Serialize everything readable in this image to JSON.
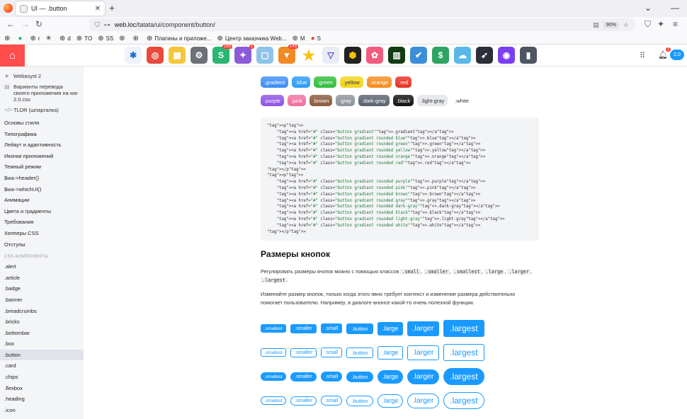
{
  "browser": {
    "tab_title": "UI — .button",
    "new_tab": "+",
    "url_host": "web.loc",
    "url_path": "/tatata/ui/component/button/",
    "zoom": "90%",
    "bookmarks": [
      {
        "label": ""
      },
      {
        "label": ""
      },
      {
        "label": "r"
      },
      {
        "label": ""
      },
      {
        "label": "d"
      },
      {
        "label": "TO"
      },
      {
        "label": "SS"
      },
      {
        "label": ""
      },
      {
        "label": ""
      },
      {
        "label": "Плагины и приложе..."
      },
      {
        "label": "Центр заказчика Web..."
      },
      {
        "label": "M"
      },
      {
        "label": "S"
      }
    ]
  },
  "appbar": {
    "apps": [
      {
        "icon": "asterisk-icon",
        "color": "#eef3fb",
        "badge": ""
      },
      {
        "icon": "lifebuoy-icon",
        "color": "#e84a3c",
        "badge": ""
      },
      {
        "icon": "notes-icon",
        "color": "#f6c63a",
        "badge": ""
      },
      {
        "icon": "gear-icon",
        "color": "#6c7078",
        "badge": ""
      },
      {
        "icon": "shop-icon",
        "color": "#2bb673",
        "badge": "185"
      },
      {
        "icon": "wand-icon",
        "color": "#8c5ad8",
        "badge": "1"
      },
      {
        "icon": "window-icon",
        "color": "#90c3e8",
        "badge": ""
      },
      {
        "icon": "cone-icon",
        "color": "#f08a24",
        "badge": "145"
      },
      {
        "icon": "star-icon",
        "color": "#f7c20e",
        "badge": ""
      },
      {
        "icon": "prism-icon",
        "color": "#e9ecf3",
        "badge": ""
      },
      {
        "icon": "hexagon-icon",
        "color": "#222222",
        "badge": ""
      },
      {
        "icon": "flower-icon",
        "color": "#f15c7e",
        "badge": ""
      },
      {
        "icon": "matrix-icon",
        "color": "#123d12",
        "badge": ""
      },
      {
        "icon": "tasks-icon",
        "color": "#3b8fd9",
        "badge": ""
      },
      {
        "icon": "money-icon",
        "color": "#2ea463",
        "badge": ""
      },
      {
        "icon": "cloud-user-icon",
        "color": "#5ab8e8",
        "badge": ""
      },
      {
        "icon": "compass-icon",
        "color": "#2b2f3a",
        "badge": ""
      },
      {
        "icon": "record-icon",
        "color": "#7b3ff2",
        "badge": ""
      },
      {
        "icon": "book-icon",
        "color": "#4e5563",
        "badge": ""
      }
    ],
    "notif_count": "1",
    "user_label": "2.0"
  },
  "sidebar": {
    "top": [
      {
        "icon": "star-icon",
        "label": "Webasyst 2"
      },
      {
        "icon": "doc-icon",
        "label": "Варианты перевода своего приложения на wa-2.0.css"
      },
      {
        "icon": "code-icon",
        "label": "TLDR (шпаргалка)"
      }
    ],
    "items": [
      "Основы стиля",
      "Типографика",
      "Лейаут и адаптивность",
      "Иконки приложений",
      "Темный режим",
      "$wa->header()",
      "$wa->whichUI()",
      "Анимации",
      "Цвета и градиенты",
      "Требования",
      "Хелперы CSS",
      "Отступы"
    ],
    "section_label": "CSS-КОМПОНЕНТЫ",
    "components": [
      ".alert",
      ".article",
      ".badge",
      ".banner",
      ".breadcrumbs",
      ".bricks",
      ".bottombar",
      ".box",
      ".button",
      ".card",
      ".chips",
      ".flexbox",
      ".heading",
      ".icon"
    ],
    "selected": ".button"
  },
  "main": {
    "gradient_row1": [
      {
        "label": ".gradient",
        "color": "#3d8df5"
      },
      {
        "label": ".blue",
        "color": "#2a9bf5"
      },
      {
        "label": ".green",
        "color": "#2fbf3a"
      },
      {
        "label": ".yellow",
        "color": "#f1d51c"
      },
      {
        "label": ".orange",
        "color": "#f58c1e"
      },
      {
        "label": ".red",
        "color": "#e53225"
      }
    ],
    "gradient_row2": [
      {
        "label": ".purple",
        "color": "#8f52e6"
      },
      {
        "label": ".pink",
        "color": "#f06fa0"
      },
      {
        "label": ".brown",
        "color": "#8a5a3c"
      },
      {
        "label": ".gray",
        "color": "#8d929b"
      },
      {
        "label": ".dark-gray",
        "color": "#5a6270"
      },
      {
        "label": ".black",
        "color": "#111111"
      },
      {
        "label": ".light-gray",
        "color": "#e3e5e9"
      },
      {
        "label": ".white",
        "color": "#ffffff"
      }
    ],
    "code_lines": [
      "<p>",
      "    <a href=\"#\" class=\"button gradient\">.gradient</a>",
      "    <a href=\"#\" class=\"button gradient rounded blue\">.blue</a>",
      "    <a href=\"#\" class=\"button gradient rounded green\">.green</a>",
      "    <a href=\"#\" class=\"button gradient rounded yellow\">.yellow</a>",
      "    <a href=\"#\" class=\"button gradient rounded orange\">.orange</a>",
      "    <a href=\"#\" class=\"button gradient rounded red\">.red</a>",
      "</p>",
      "<p>",
      "    <a href=\"#\" class=\"button gradient rounded purple\">.purple</a>",
      "    <a href=\"#\" class=\"button gradient rounded pink\">.pink</a>",
      "    <a href=\"#\" class=\"button gradient rounded brown\">.brown</a>",
      "    <a href=\"#\" class=\"button gradient rounded gray\">.gray</a>",
      "    <a href=\"#\" class=\"button gradient rounded dark-gray\">.dark-gray</a>",
      "    <a href=\"#\" class=\"button gradient rounded black\">.black</a>",
      "    <a href=\"#\" class=\"button gradient rounded light-gray\">.light-gray</a>",
      "    <a href=\"#\" class=\"button gradient rounded white\">.white</a>",
      "</p>"
    ],
    "sizes_heading": "Размеры кнопок",
    "para1_text": "Регулировать размеры кнопок можно с помощью классов",
    "para1_classes": [
      ".small",
      ".smaller",
      ".smallest",
      ".large",
      ".larger",
      ".largest"
    ],
    "para2": "Изменяйте размер кнопок, только когда этого явно требует контекст и изменение размера действительно помогает пользователю. Например, в диалоге-анонсе какой-то очень полезной функции.",
    "size_labels": [
      ".smallest",
      ".smaller",
      ".small",
      ".button",
      ".large",
      ".larger",
      ".largest"
    ]
  }
}
